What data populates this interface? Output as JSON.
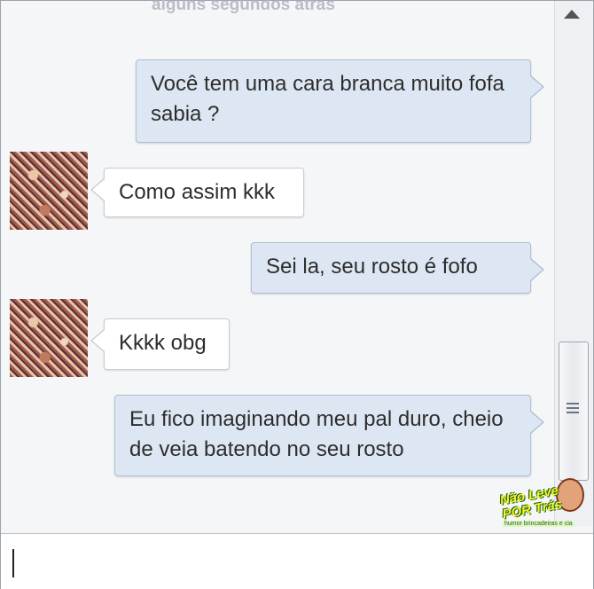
{
  "chat": {
    "timestamp": "alguns segundos atrás",
    "messages": [
      {
        "from": "me",
        "text": "Você tem uma cara branca muito fofa sabia ?"
      },
      {
        "from": "other",
        "text": "Como assim kkk"
      },
      {
        "from": "me",
        "text": "Sei la, seu rosto é fofo"
      },
      {
        "from": "other",
        "text": "Kkkk obg"
      },
      {
        "from": "me",
        "text": "Eu fico imaginando meu pal duro, cheio de veia batendo no seu rosto"
      }
    ]
  },
  "input": {
    "value": ""
  },
  "watermark": {
    "line1": "Não Leve",
    "line2": "POR Trás",
    "tagline": "humor brincadeiras e cia"
  },
  "icons": {
    "scroll_up": "triangle-up-icon",
    "scroll_grip": "grip-icon"
  },
  "colors": {
    "sent_bubble": "#dde7f3",
    "received_bubble": "#ffffff",
    "background": "#f5f6f8"
  }
}
